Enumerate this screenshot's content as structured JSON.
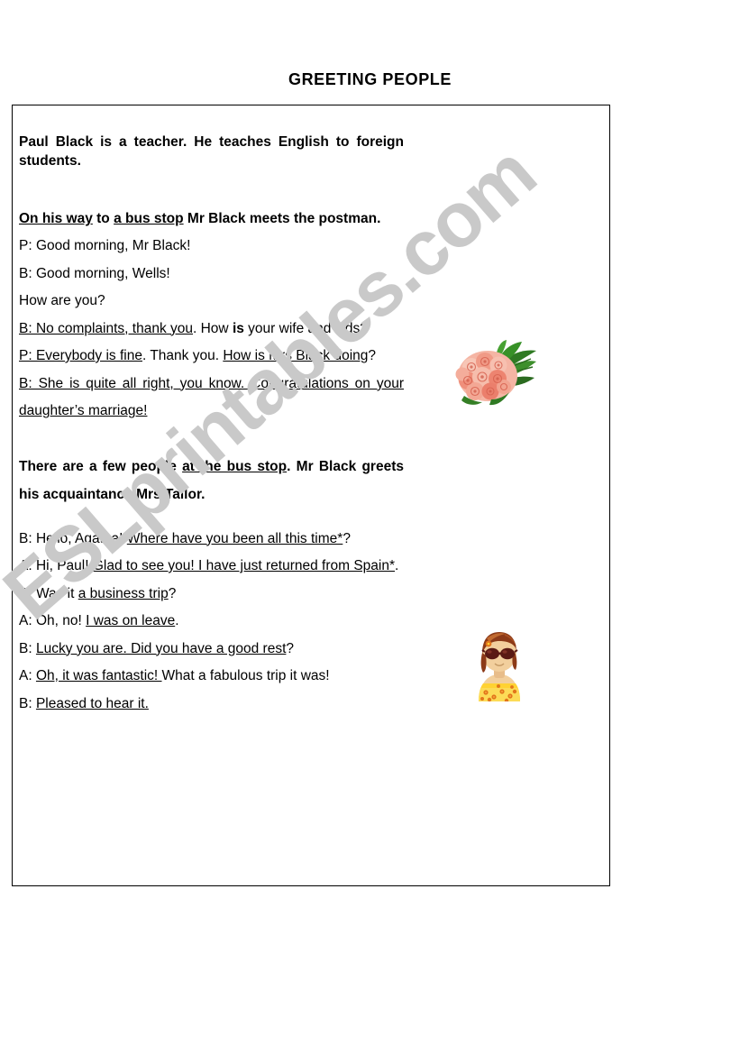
{
  "page": {
    "title": "GREETING PEOPLE",
    "background_color": "#ffffff",
    "border_color": "#000000"
  },
  "watermark": {
    "text": "ESLprintables.com",
    "color": "#c9c9c9",
    "rotation_deg": -41
  },
  "worksheet": {
    "intro": {
      "text": "Paul Black is a teacher. He teaches English to foreign students."
    },
    "scene_one": {
      "narration_parts": [
        {
          "text": "On his way",
          "underline": true,
          "bold": true
        },
        {
          "text": " to ",
          "underline": false,
          "bold": true
        },
        {
          "text": "a bus stop",
          "underline": true,
          "bold": true
        },
        {
          "text": " Mr Black meets the postman.",
          "underline": false,
          "bold": true
        }
      ],
      "lines": [
        {
          "id": "line-1",
          "parts": [
            {
              "text": "P: Good morning, Mr Black!",
              "underline": false,
              "bold": false
            }
          ]
        },
        {
          "id": "line-2",
          "parts": [
            {
              "text": "B: Good morning, Wells!",
              "underline": false,
              "bold": false
            }
          ]
        },
        {
          "id": "line-3",
          "parts": [
            {
              "text": "How are you?",
              "underline": false,
              "bold": false
            }
          ]
        },
        {
          "id": "line-4",
          "parts": [
            {
              "text": "B: No complaints, thank you",
              "underline": true,
              "bold": false
            },
            {
              "text": ". How ",
              "underline": false,
              "bold": false
            },
            {
              "text": "is",
              "underline": false,
              "bold": true
            },
            {
              "text": " your wife and kids?",
              "underline": false,
              "bold": false
            }
          ]
        },
        {
          "id": "line-5",
          "parts": [
            {
              "text": "P: Everybody is fine",
              "underline": true,
              "bold": false
            },
            {
              "text": ". Thank you. ",
              "underline": false,
              "bold": false
            },
            {
              "text": "How is Mrs Black doing",
              "underline": true,
              "bold": false
            },
            {
              "text": "?",
              "underline": false,
              "bold": false
            }
          ]
        },
        {
          "id": "line-6",
          "parts": [
            {
              "text": "B: She is quite all right, you know. Congratulations on your daughter’s marriage!",
              "underline": true,
              "bold": false
            }
          ]
        }
      ]
    },
    "scene_two": {
      "narration_parts": [
        {
          "text": "There are a few people ",
          "underline": false,
          "bold": true
        },
        {
          "text": "at the bus stop",
          "underline": true,
          "bold": true
        },
        {
          "text": ". Mr Black greets his acquaintance Mrs Tailor.",
          "underline": false,
          "bold": true
        }
      ],
      "lines": [
        {
          "id": "line-7",
          "parts": [
            {
              "text": "B: Hello, Agatha! ",
              "underline": false,
              "bold": false
            },
            {
              "text": "Where have you been all this time*",
              "underline": true,
              "bold": false
            },
            {
              "text": "?",
              "underline": false,
              "bold": false
            }
          ]
        },
        {
          "id": "line-8",
          "parts": [
            {
              "text": "A: Hi, Paul! ",
              "underline": false,
              "bold": false
            },
            {
              "text": "Glad to see you! I have just returned from Spain*",
              "underline": true,
              "bold": false
            },
            {
              "text": ".",
              "underline": false,
              "bold": false
            }
          ]
        },
        {
          "id": "line-9",
          "parts": [
            {
              "text": "B: Was it ",
              "underline": false,
              "bold": false
            },
            {
              "text": "a business trip",
              "underline": true,
              "bold": false
            },
            {
              "text": "?",
              "underline": false,
              "bold": false
            }
          ]
        },
        {
          "id": "line-10",
          "parts": [
            {
              "text": "A: Oh, no! ",
              "underline": false,
              "bold": false
            },
            {
              "text": "I was on leave",
              "underline": true,
              "bold": false
            },
            {
              "text": ".",
              "underline": false,
              "bold": false
            }
          ]
        },
        {
          "id": "line-11",
          "parts": [
            {
              "text": "B: ",
              "underline": false,
              "bold": false
            },
            {
              "text": "Lucky you are. Did you have a good rest",
              "underline": true,
              "bold": false
            },
            {
              "text": "?",
              "underline": false,
              "bold": false
            }
          ]
        },
        {
          "id": "line-12",
          "parts": [
            {
              "text": "A: ",
              "underline": false,
              "bold": false
            },
            {
              "text": "Oh, it was fantastic! ",
              "underline": true,
              "bold": false
            },
            {
              "text": "What a fabulous trip it was!",
              "underline": false,
              "bold": false
            }
          ]
        },
        {
          "id": "line-13",
          "parts": [
            {
              "text": "B: ",
              "underline": false,
              "bold": false
            },
            {
              "text": "Pleased to hear it.",
              "underline": true,
              "bold": false
            }
          ]
        }
      ]
    }
  },
  "images": {
    "bouquet": {
      "name": "pink-rose-bouquet",
      "petal_color": "#f0907f",
      "petal_light": "#f8c3b4",
      "leaf_color": "#2f7a23"
    },
    "avatar": {
      "name": "woman-with-sunglasses-avatar",
      "hair_color": "#8c3a18",
      "hair_highlight": "#c06a30",
      "skin_color": "#f0c89a",
      "glasses_color": "#5a1a14",
      "dress_color": "#ffd233",
      "flower_color": "#e2761b"
    }
  }
}
